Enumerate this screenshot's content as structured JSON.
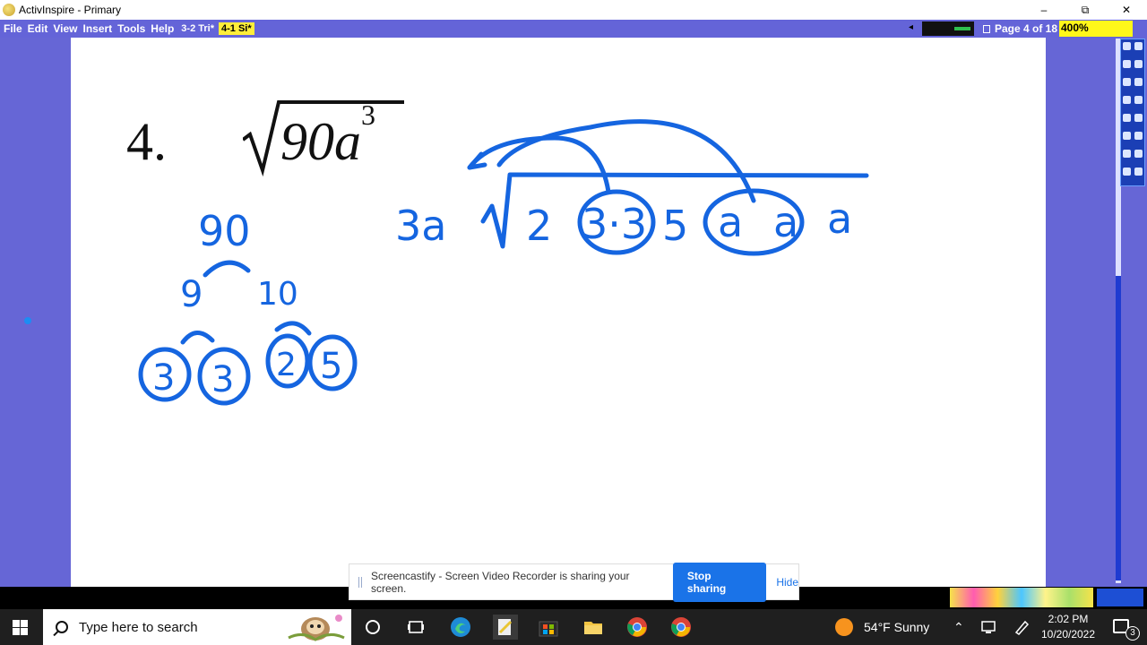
{
  "window": {
    "title": "ActivInspire - Primary",
    "controls": {
      "minimize": "–",
      "restore": "⧉",
      "close": "✕"
    }
  },
  "menubar": {
    "items": [
      "File",
      "Edit",
      "View",
      "Insert",
      "Tools",
      "Help"
    ],
    "doc_tabs": [
      "3-2 Tri*",
      "4-1 Si*"
    ],
    "page_indicator": "Page 4 of 18",
    "zoom": "400%"
  },
  "flipchart": {
    "problem_number": "4.",
    "radicand_base": "90a",
    "radicand_exponent": "3",
    "handwriting": {
      "factor_tree_root": "90",
      "factor_tree_level1": [
        "9",
        "10"
      ],
      "factor_tree_leaves": [
        "3",
        "3",
        "2",
        "5"
      ],
      "coefficient": "3a",
      "under_radical": [
        "2",
        "3·3",
        "5",
        "a",
        "a",
        "a"
      ]
    },
    "ink_color": "#1565e0"
  },
  "screencastify": {
    "message": "Screencastify - Screen Video Recorder is sharing your screen.",
    "stop_label": "Stop sharing",
    "hide_label": "Hide"
  },
  "taskbar": {
    "search_placeholder": "Type here to search",
    "weather": "54°F  Sunny",
    "time": "2:02 PM",
    "date": "10/20/2022",
    "notification_count": "3",
    "icons": [
      "windows-icon",
      "task-view-icon",
      "edge-icon",
      "activinspire-icon",
      "store-icon",
      "file-explorer-icon",
      "chrome-icon",
      "chrome-icon"
    ]
  },
  "colors": {
    "workspace": "#6666d6",
    "zoom_highlight": "#fff71a",
    "tab_highlight": "#ffee3a",
    "accent_blue": "#1a73e8"
  }
}
